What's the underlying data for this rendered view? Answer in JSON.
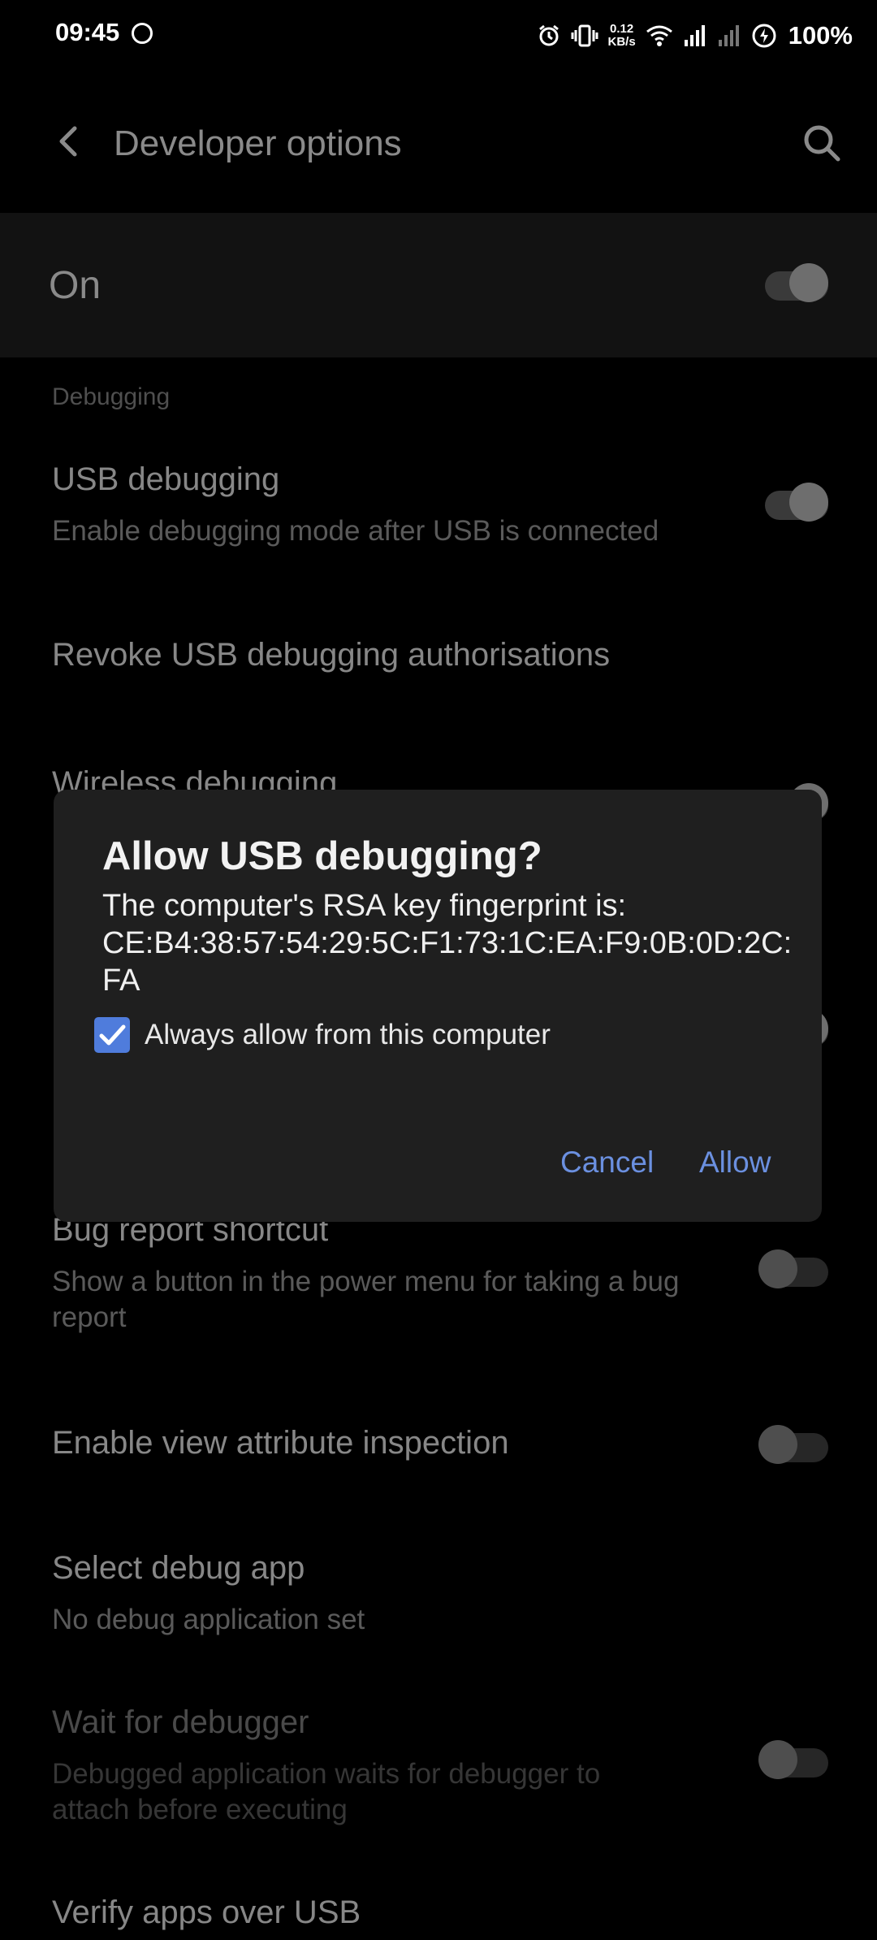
{
  "status_bar": {
    "time": "09:45",
    "net_speed_value": "0.12",
    "net_speed_unit": "KB/s",
    "battery": "100%",
    "icons": [
      "face-icon",
      "alarm-icon",
      "vibrate-icon",
      "wifi-icon",
      "signal-icon",
      "signal-icon-2",
      "battery-saver-icon"
    ]
  },
  "appbar": {
    "title": "Developer options"
  },
  "master_switch": {
    "label": "On",
    "state": "on"
  },
  "section": {
    "header": "Debugging"
  },
  "rows": {
    "usb_debugging": {
      "title": "USB debugging",
      "subtitle": "Enable debugging mode after USB is connected",
      "state": "on"
    },
    "revoke": {
      "title": "Revoke USB debugging authorisations"
    },
    "wireless": {
      "title": "Wireless debugging"
    },
    "bug_report": {
      "title": "Bug report shortcut",
      "subtitle": "Show a button in the power menu for taking a bug report",
      "state": "off"
    },
    "view_attr": {
      "title": "Enable view attribute inspection",
      "state": "off"
    },
    "debug_app": {
      "title": "Select debug app",
      "subtitle": "No debug application set"
    },
    "wait_debugger": {
      "title": "Wait for debugger",
      "subtitle": "Debugged application waits for debugger to attach before executing",
      "state": "off"
    },
    "verify_usb": {
      "title": "Verify apps over USB"
    }
  },
  "dialog": {
    "title": "Allow USB debugging?",
    "message_line1": "The computer's RSA key fingerprint is:",
    "fingerprint": "CE:B4:38:57:54:29:5C:F1:73:1C:EA:F9:0B:0D:2C:FA",
    "checkbox_label": "Always allow from this computer",
    "checkbox_checked": true,
    "cancel_label": "Cancel",
    "allow_label": "Allow"
  },
  "colors": {
    "accent": "#6b90e0",
    "checkbox": "#4f7cdc",
    "dialog_bg": "#1f1f1f"
  }
}
